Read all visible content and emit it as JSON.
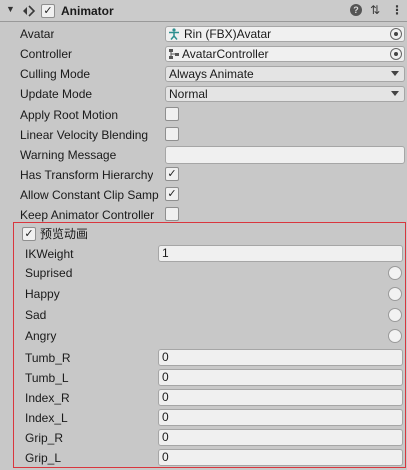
{
  "component": {
    "title": "Animator",
    "enabled_mark": "✓"
  },
  "fields": {
    "avatar_label": "Avatar",
    "avatar_value": "Rin (FBX)Avatar",
    "controller_label": "Controller",
    "controller_value": "AvatarController",
    "culling_label": "Culling Mode",
    "culling_value": "Always Animate",
    "update_label": "Update Mode",
    "update_value": "Normal",
    "apply_root_label": "Apply Root Motion",
    "apply_root_checked": "",
    "linear_velocity_label": "Linear Velocity Blending",
    "linear_velocity_checked": "",
    "warning_label": "Warning Message",
    "warning_value": "",
    "transform_label": "Has Transform Hierarchy",
    "transform_checked": "✓",
    "constant_clip_label": "Allow Constant Clip Samp",
    "constant_clip_checked": "✓",
    "keep_controller_label": "Keep Animator Controller",
    "keep_controller_checked": ""
  },
  "preview": {
    "toggle_label": "预览动画",
    "toggle_checked": "✓",
    "ikweight_label": "IKWeight",
    "ikweight_value": "1",
    "expressions": [
      {
        "label": "Suprised"
      },
      {
        "label": "Happy"
      },
      {
        "label": "Sad"
      },
      {
        "label": "Angry"
      }
    ],
    "fingers": [
      {
        "label": "Tumb_R",
        "value": "0"
      },
      {
        "label": "Tumb_L",
        "value": "0"
      },
      {
        "label": "Index_R",
        "value": "0"
      },
      {
        "label": "Index_L",
        "value": "0"
      },
      {
        "label": "Grip_R",
        "value": "0"
      },
      {
        "label": "Grip_L",
        "value": "0"
      }
    ]
  },
  "icons": {
    "collapse": "▼",
    "component": "animator-icon",
    "help": "?",
    "presets": "⇅",
    "menu": "⋮"
  },
  "colors": {
    "highlight_border": "#d9363e",
    "panel_bg": "#c8c8c8"
  }
}
